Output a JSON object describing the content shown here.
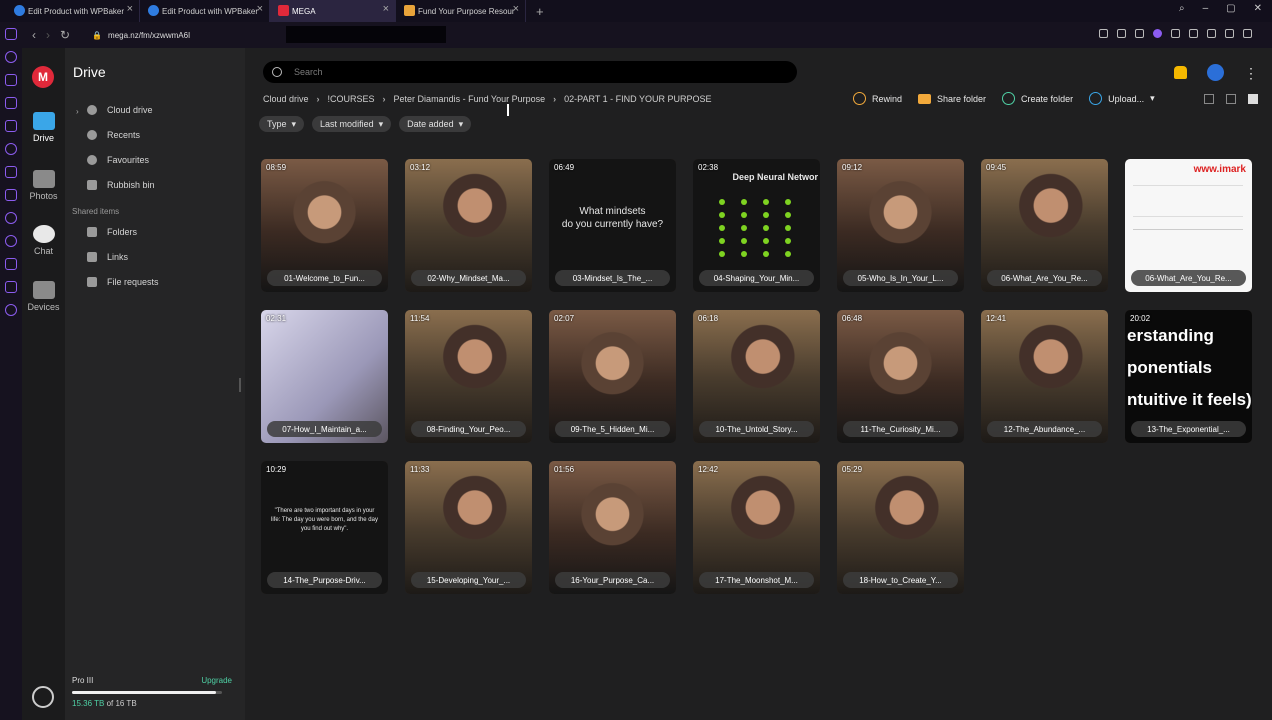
{
  "browser": {
    "tabs": [
      {
        "title": "Edit Product with WPBaker"
      },
      {
        "title": "Edit Product with WPBaker"
      },
      {
        "title": "MEGA"
      },
      {
        "title": "Fund Your Purpose Resour"
      }
    ],
    "url": "mega.nz/fm/xzwwmA6I"
  },
  "rail": {
    "logo": "M",
    "items": [
      {
        "label": "Drive",
        "icon": "folder-icon"
      },
      {
        "label": "Photos",
        "icon": "photo-icon"
      },
      {
        "label": "Chat",
        "icon": "chat-icon"
      },
      {
        "label": "Devices",
        "icon": "device-icon"
      }
    ]
  },
  "sidebar": {
    "title": "Drive",
    "items": [
      {
        "label": "Cloud drive",
        "icon": "cloud-icon"
      },
      {
        "label": "Recents",
        "icon": "clock-icon"
      },
      {
        "label": "Favourites",
        "icon": "heart-icon"
      },
      {
        "label": "Rubbish bin",
        "icon": "trash-icon"
      }
    ],
    "shared_title": "Shared items",
    "shared": [
      {
        "label": "Folders",
        "icon": "shared-folder-icon"
      },
      {
        "label": "Links",
        "icon": "link-icon"
      },
      {
        "label": "File requests",
        "icon": "file-request-icon"
      }
    ],
    "storage": {
      "plan": "Pro III",
      "upgrade": "Upgrade",
      "used": "15.36 TB",
      "of": "of 16 TB",
      "used_fraction": 0.96
    }
  },
  "search": {
    "placeholder": "Search"
  },
  "breadcrumb": [
    "Cloud drive",
    "!COURSES",
    "Peter Diamandis - Fund Your Purpose",
    "02-PART 1 - FIND YOUR PURPOSE"
  ],
  "actions": {
    "rewind": "Rewind",
    "share": "Share folder",
    "create": "Create folder",
    "upload": "Upload..."
  },
  "filters": [
    "Type",
    "Last modified",
    "Date added"
  ],
  "files": [
    {
      "duration": "08:59",
      "name": "01-Welcome_to_Fun..."
    },
    {
      "duration": "03:12",
      "name": "02-Why_Mindset_Ma..."
    },
    {
      "duration": "06:49",
      "name": "03-Mindset_Is_The_...",
      "overlay": "What mindsets\ndo you currently have?"
    },
    {
      "duration": "02:38",
      "name": "04-Shaping_Your_Min...",
      "overlay": "Deep Neural Networ"
    },
    {
      "duration": "09:12",
      "name": "05-Who_Is_In_Your_L..."
    },
    {
      "duration": "09:45",
      "name": "06-What_Are_You_Re..."
    },
    {
      "duration": "",
      "name": "06-What_Are_You_Re...",
      "overlay": "www.imark"
    },
    {
      "duration": "02:31",
      "name": "07-How_I_Maintain_a..."
    },
    {
      "duration": "11:54",
      "name": "08-Finding_Your_Peo..."
    },
    {
      "duration": "02:07",
      "name": "09-The_5_Hidden_Mi..."
    },
    {
      "duration": "06:18",
      "name": "10-The_Untold_Story..."
    },
    {
      "duration": "06:48",
      "name": "11-The_Curiosity_Mi..."
    },
    {
      "duration": "12:41",
      "name": "12-The_Abundance_..."
    },
    {
      "duration": "20:02",
      "name": "13-The_Exponential_...",
      "overlay": "erstanding\nponentials\nntuitive it feels)"
    },
    {
      "duration": "10:29",
      "name": "14-The_Purpose-Driv...",
      "overlay": "\"There are two important days in your life: The day you were born, and the day you find out why\"."
    },
    {
      "duration": "11:33",
      "name": "15-Developing_Your_..."
    },
    {
      "duration": "01:56",
      "name": "16-Your_Purpose_Ca..."
    },
    {
      "duration": "12:42",
      "name": "17-The_Moonshot_M..."
    },
    {
      "duration": "05:29",
      "name": "18-How_to_Create_Y..."
    }
  ]
}
